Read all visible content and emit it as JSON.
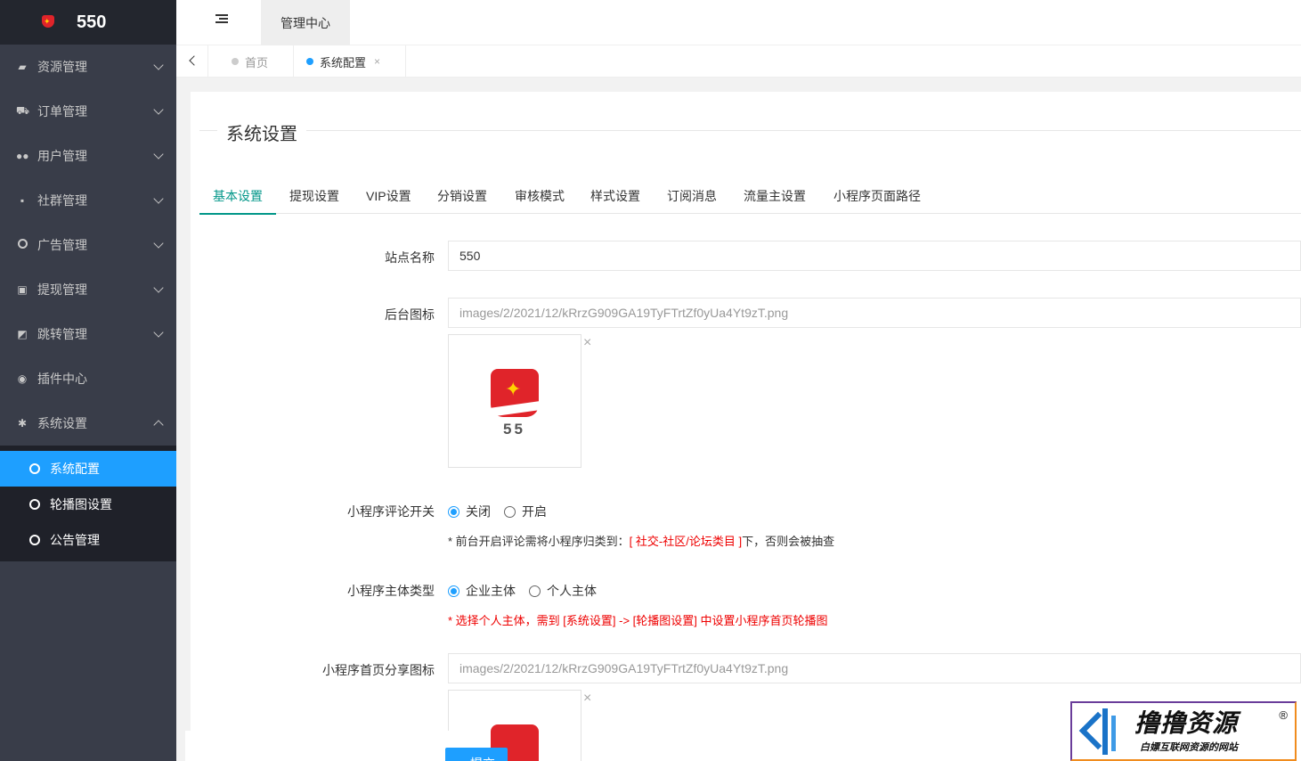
{
  "app": {
    "title": "550",
    "nav_title": "管理中心"
  },
  "sidebar": {
    "items": [
      {
        "label": "资源管理",
        "icon": "book-icon"
      },
      {
        "label": "订单管理",
        "icon": "cart-icon"
      },
      {
        "label": "用户管理",
        "icon": "users-icon"
      },
      {
        "label": "社群管理",
        "icon": "chat-icon"
      },
      {
        "label": "广告管理",
        "icon": "circle-icon"
      },
      {
        "label": "提现管理",
        "icon": "money-icon"
      },
      {
        "label": "跳转管理",
        "icon": "share-icon"
      },
      {
        "label": "插件中心",
        "icon": "plugin-icon"
      },
      {
        "label": "系统设置",
        "icon": "gear-icon"
      }
    ],
    "subitems": [
      {
        "label": "系统配置"
      },
      {
        "label": "轮播图设置"
      },
      {
        "label": "公告管理"
      }
    ]
  },
  "pagetabs": {
    "home": "首页",
    "current": "系统配置",
    "close": "×"
  },
  "card": {
    "legend": "系统设置",
    "tabs": [
      "基本设置",
      "提现设置",
      "VIP设置",
      "分销设置",
      "审核模式",
      "样式设置",
      "订阅消息",
      "流量主设置",
      "小程序页面路径"
    ]
  },
  "form": {
    "site_name_label": "站点名称",
    "site_name_value": "550",
    "admin_icon_label": "后台图标",
    "admin_icon_value": "images/2/2021/12/kRrzG909GA19TyFTrtZf0yUa4Yt9zT.png",
    "logo_text": "55",
    "remove": "×",
    "comment_label": "小程序评论开关",
    "comment_off": "关闭",
    "comment_on": "开启",
    "comment_hint_prefix": "* 前台开启评论需将小程序归类到：",
    "comment_hint_red": "[ 社交-社区/论坛类目 ]",
    "comment_hint_suffix": "下，否则会被抽查",
    "subject_label": "小程序主体类型",
    "subject_enterprise": "企业主体",
    "subject_personal": "个人主体",
    "subject_hint": "* 选择个人主体，需到 [系统设置] -> [轮播图设置] 中设置小程序首页轮播图",
    "share_icon_label": "小程序首页分享图标",
    "share_icon_value": "images/2/2021/12/kRrzG909GA19TyFTrtZf0yUa4Yt9zT.png",
    "submit": "提交"
  },
  "watermark": {
    "title": "撸撸资源",
    "subtitle": "白嫖互联网资源的网站",
    "reg": "®"
  },
  "colors": {
    "sidebar_bg": "#393d49",
    "active_blue": "#1e9fff",
    "tab_green": "#009688",
    "hint_red": "#ee0000"
  }
}
